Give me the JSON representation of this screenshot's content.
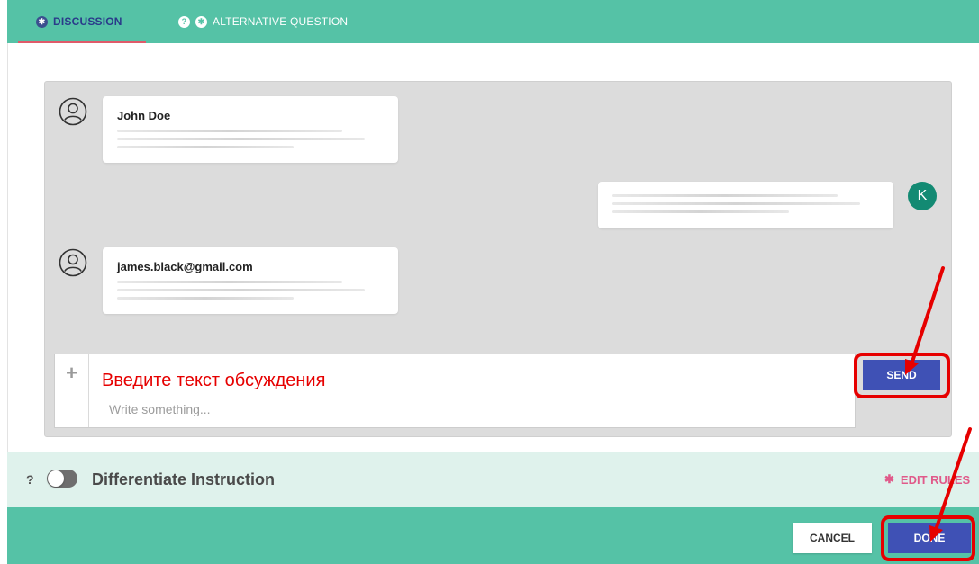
{
  "tabs": [
    {
      "label": "DISCUSSION",
      "icon": "settings-dot-icon",
      "active": true
    },
    {
      "label": "ALTERNATIVE QUESTION",
      "icon": "help-dot-icon",
      "active": false
    }
  ],
  "messages": [
    {
      "author": "John Doe",
      "side": "left",
      "avatar": "user-outline-icon"
    },
    {
      "author": "",
      "side": "right",
      "avatar_letter": "K"
    },
    {
      "author": "james.black@gmail.com",
      "side": "left",
      "avatar": "user-outline-icon"
    }
  ],
  "composer": {
    "annotation": "Введите текст обсуждения",
    "placeholder": "Write something...",
    "send_label": "SEND"
  },
  "differentiate": {
    "help": "?",
    "label": "Differentiate Instruction",
    "enabled": false,
    "edit_rules_label": "EDIT RULES"
  },
  "footer": {
    "cancel_label": "CANCEL",
    "done_label": "DONE"
  },
  "colors": {
    "teal": "#55c2a6",
    "indigo": "#3f51b5",
    "annotation_red": "#e60000",
    "pink": "#e05a8a",
    "avatar_green": "#138a73"
  }
}
